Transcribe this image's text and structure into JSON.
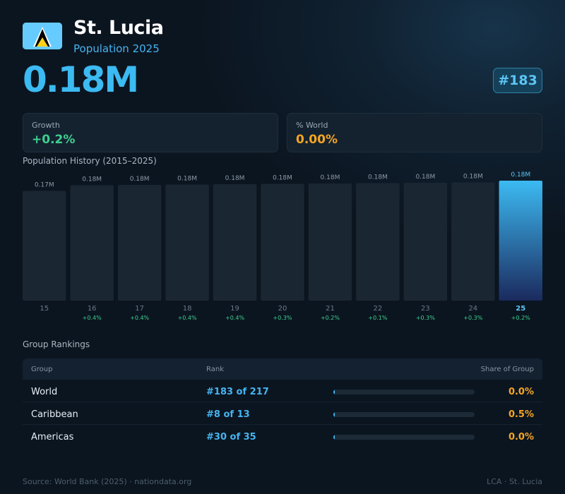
{
  "header": {
    "country": "St. Lucia",
    "subtitle": "Population 2025",
    "population": "0.18M",
    "rank": "#183",
    "flag_icon": "st-lucia-flag",
    "flag_colors": {
      "field": "#66ccff",
      "white": "#ffffff",
      "black": "#000000",
      "gold": "#fcd116"
    }
  },
  "stats": {
    "growth": {
      "label": "Growth",
      "value": "+0.2%",
      "color": "#3ecf8e"
    },
    "world": {
      "label": "% World",
      "value": "0.00%",
      "color": "#f5a623"
    }
  },
  "history_title": "Population History (2015–2025)",
  "chart_data": {
    "type": "bar",
    "title": "Population History (2015–2025)",
    "categories": [
      "15",
      "16",
      "17",
      "18",
      "19",
      "20",
      "21",
      "22",
      "23",
      "24",
      "25"
    ],
    "values": [
      0.17,
      0.18,
      0.18,
      0.18,
      0.18,
      0.18,
      0.18,
      0.18,
      0.18,
      0.18,
      0.18
    ],
    "value_labels": [
      "0.17M",
      "0.18M",
      "0.18M",
      "0.18M",
      "0.18M",
      "0.18M",
      "0.18M",
      "0.18M",
      "0.18M",
      "0.18M",
      "0.18M"
    ],
    "growth_labels": [
      "",
      "+0.4%",
      "+0.4%",
      "+0.4%",
      "+0.4%",
      "+0.3%",
      "+0.2%",
      "+0.1%",
      "+0.3%",
      "+0.3%",
      "+0.2%"
    ],
    "highlight_index": 10,
    "colors": {
      "bar": "#1a2632",
      "highlight_top": "#3cbaf2",
      "highlight_bottom": "#1b2a5e",
      "growth": "#3ecf8e",
      "value_label": "#8c9aa8",
      "highlight_label": "#5cc6f4"
    }
  },
  "rankings": {
    "title": "Group Rankings",
    "columns": {
      "group": "Group",
      "rank": "Rank",
      "share": "Share of Group"
    },
    "rows": [
      {
        "group": "World",
        "rank": "#183 of 217",
        "share": "0.0%",
        "share_value": 0.0
      },
      {
        "group": "Caribbean",
        "rank": "#8 of 13",
        "share": "0.5%",
        "share_value": 0.5
      },
      {
        "group": "Americas",
        "rank": "#30 of 35",
        "share": "0.0%",
        "share_value": 0.0
      }
    ]
  },
  "footer": {
    "source": "Source: World Bank (2025) · nationdata.org",
    "code": "LCA · St. Lucia"
  }
}
